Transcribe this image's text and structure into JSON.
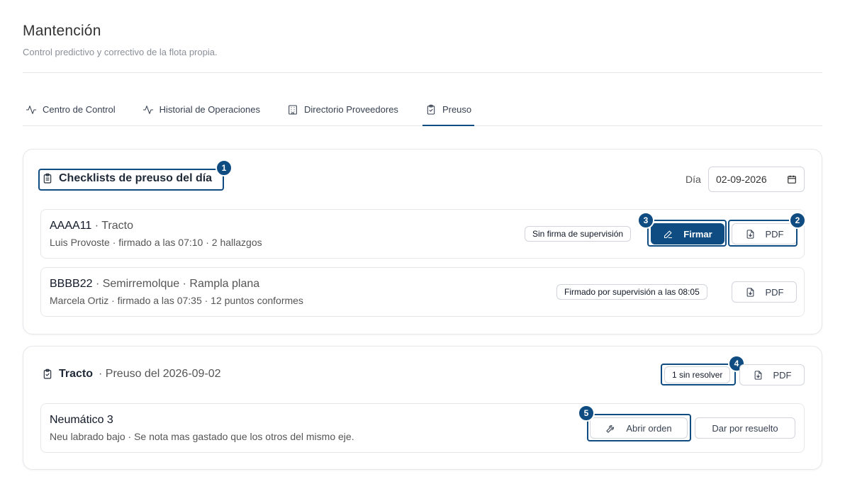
{
  "header": {
    "title": "Mantención",
    "subtitle": "Control predictivo y correctivo de la flota propia."
  },
  "tabs": [
    {
      "label": "Centro de Control",
      "icon": "activity-icon"
    },
    {
      "label": "Historial de Operaciones",
      "icon": "activity-icon"
    },
    {
      "label": "Directorio Proveedores",
      "icon": "building-icon"
    },
    {
      "label": "Preuso",
      "icon": "clipboard-check-icon",
      "active": true
    }
  ],
  "checklists": {
    "title": "Checklists de preuso del día",
    "day_label": "Día",
    "day_value": "02-09-2026",
    "items": [
      {
        "plate": "AAAA11",
        "type": "· Tracto",
        "subtitle": "Luis Provoste · firmado a las 07:10 · 2 hallazgos",
        "status": "Sin firma de supervisión",
        "sign_label": "Firmar",
        "pdf_label": "PDF"
      },
      {
        "plate": "BBBB22",
        "type": "· Semirremolque · Rampla plana",
        "subtitle": "Marcela Ortiz · firmado a las 07:35 · 12 puntos conformes",
        "status": "Firmado por supervisión a las 08:05",
        "pdf_label": "PDF"
      }
    ]
  },
  "detail": {
    "title": "Tracto",
    "subtitle": "· Preuso del 2026-09-02",
    "unresolved": "1 sin resolver",
    "pdf_label": "PDF",
    "finding": {
      "title": "Neumático 3",
      "subtitle": "Neu labrado bajo · Se nota mas gastado que los otros del mismo eje.",
      "open_order_label": "Abrir orden",
      "resolve_label": "Dar por resuelto"
    }
  },
  "markers": [
    "1",
    "2",
    "3",
    "4",
    "5"
  ],
  "colors": {
    "accent": "#0f4c81",
    "border": "#e5e7eb"
  }
}
